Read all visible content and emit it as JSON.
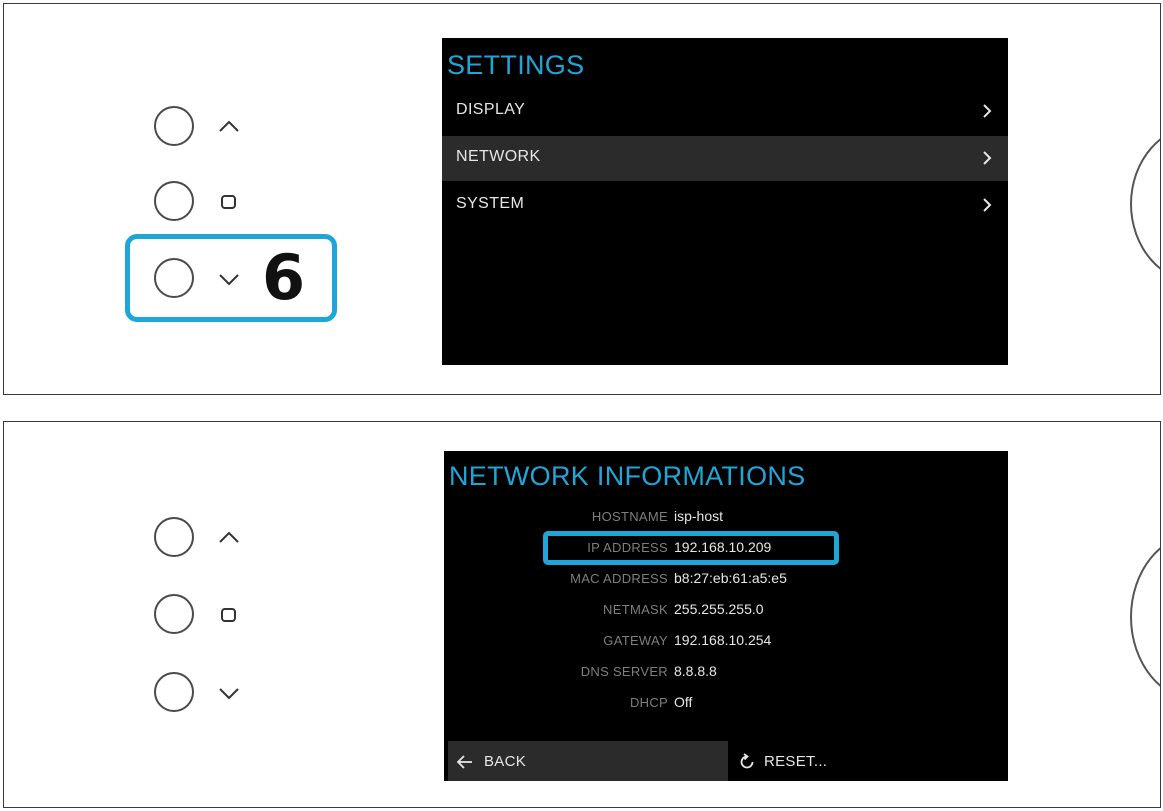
{
  "settings_screen": {
    "title": "SETTINGS",
    "items": [
      {
        "label": "DISPLAY"
      },
      {
        "label": "NETWORK",
        "selected": true
      },
      {
        "label": "SYSTEM"
      }
    ]
  },
  "callout": {
    "step_number": "6"
  },
  "network_screen": {
    "title": "NETWORK INFORMATIONS",
    "rows": [
      {
        "label": "HOSTNAME",
        "value": "isp-host"
      },
      {
        "label": "IP ADDRESS",
        "value": "192.168.10.209"
      },
      {
        "label": "MAC ADDRESS",
        "value": "b8:27:eb:61:a5:e5"
      },
      {
        "label": "NETMASK",
        "value": "255.255.255.0"
      },
      {
        "label": "GATEWAY",
        "value": "192.168.10.254"
      },
      {
        "label": "DNS SERVER",
        "value": "8.8.8.8"
      },
      {
        "label": "DHCP",
        "value": "Off"
      }
    ],
    "back_label": "BACK",
    "reset_label": "RESET..."
  },
  "colors": {
    "accent": "#1fa6d9",
    "screen_bg": "#000000",
    "selected_row": "#2b2b2b"
  },
  "icons": [
    "chevron-up-icon",
    "square-icon",
    "chevron-down-icon",
    "chevron-right-icon",
    "arrow-left-icon",
    "reset-icon"
  ]
}
